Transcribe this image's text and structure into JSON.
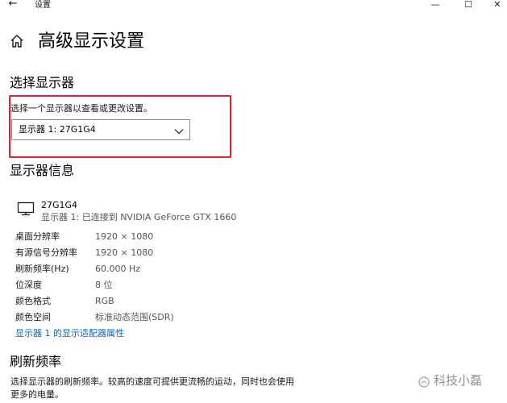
{
  "titlebar": {
    "back_glyph": "←",
    "title": "设置",
    "minimize_glyph": "—",
    "maximize_glyph": "☐",
    "close_glyph": "✕"
  },
  "header": {
    "title": "高级显示设置",
    "home_icon": "home-icon"
  },
  "select_display": {
    "heading": "选择显示器",
    "description": "选择一个显示器以查看或更改设置。",
    "selected_value": "显示器 1: 27G1G4",
    "highlight_color": "#e0202a"
  },
  "display_info": {
    "heading": "显示器信息",
    "monitor_name": "27G1G4",
    "monitor_subtitle": "显示器 1: 已连接到 NVIDIA GeForce GTX 1660",
    "properties": [
      {
        "label": "桌面分辨率",
        "value": "1920 × 1080"
      },
      {
        "label": "有源信号分辨率",
        "value": "1920 × 1080"
      },
      {
        "label": "刷新频率(Hz)",
        "value": "60.000 Hz"
      },
      {
        "label": "位深度",
        "value": "8 位"
      },
      {
        "label": "颜色格式",
        "value": "RGB"
      },
      {
        "label": "颜色空间",
        "value": "标准动态范围(SDR)"
      }
    ],
    "adapter_link": "显示器 1 的显示适配器属性",
    "link_color": "#0067c0"
  },
  "refresh_rate": {
    "heading": "刷新频率",
    "description_line1": "选择显示器的刷新频率。较高的速度可提供更流畅的运动，同时也会使用",
    "description_line2": "更多的电量。"
  },
  "watermark": {
    "text": "科技小磊"
  }
}
